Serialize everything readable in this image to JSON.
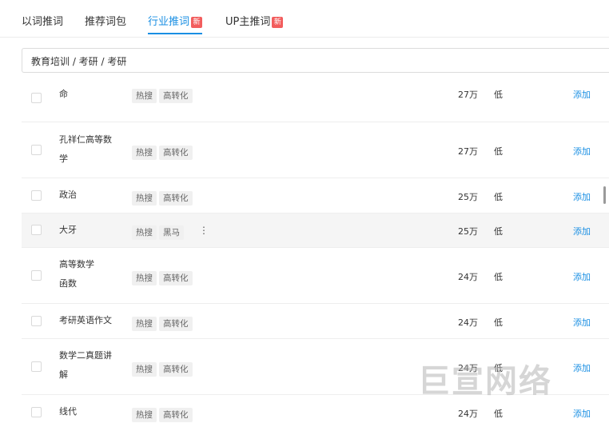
{
  "tabs": [
    {
      "label": "以词推词",
      "active": false,
      "badge": ""
    },
    {
      "label": "推荐词包",
      "active": false,
      "badge": ""
    },
    {
      "label": "行业推词",
      "active": true,
      "badge": "新"
    },
    {
      "label": "UP主推词",
      "active": false,
      "badge": "新"
    }
  ],
  "breadcrumb": "教育培训 / 考研 / 考研",
  "table": {
    "rows": [
      {
        "keyword_lines": [
          "",
          "命"
        ],
        "tags": [
          "热搜",
          "高转化"
        ],
        "volume": "27万",
        "competition": "低",
        "action": "添加"
      },
      {
        "keyword_lines": [
          "孔祥仁高等数",
          "学"
        ],
        "tags": [
          "热搜",
          "高转化"
        ],
        "volume": "27万",
        "competition": "低",
        "action": "添加"
      },
      {
        "keyword_lines": [
          "政治"
        ],
        "tags": [
          "热搜",
          "高转化"
        ],
        "volume": "25万",
        "competition": "低",
        "action": "添加"
      },
      {
        "keyword_lines": [
          "大牙"
        ],
        "tags": [
          "热搜",
          "黑马"
        ],
        "volume": "25万",
        "competition": "低",
        "action": "添加",
        "more": "⋮"
      },
      {
        "keyword_lines": [
          "高等数学",
          "函数"
        ],
        "tags": [
          "热搜",
          "高转化"
        ],
        "volume": "24万",
        "competition": "低",
        "action": "添加"
      },
      {
        "keyword_lines": [
          "考研英语作文"
        ],
        "tags": [
          "热搜",
          "高转化"
        ],
        "volume": "24万",
        "competition": "低",
        "action": "添加"
      },
      {
        "keyword_lines": [
          "数学二真题讲",
          "解"
        ],
        "tags": [
          "热搜",
          "高转化"
        ],
        "volume": "24万",
        "competition": "低",
        "action": "添加"
      },
      {
        "keyword_lines": [
          "线代"
        ],
        "tags": [
          "热搜",
          "高转化"
        ],
        "volume": "24万",
        "competition": "低",
        "action": "添加"
      }
    ]
  },
  "watermark": "巨宣网络",
  "colors": {
    "accent": "#1a8fe3",
    "badge": "#f25d5d",
    "tag_bg": "#f0f0f0",
    "row_highlight": "#f5f5f5"
  }
}
